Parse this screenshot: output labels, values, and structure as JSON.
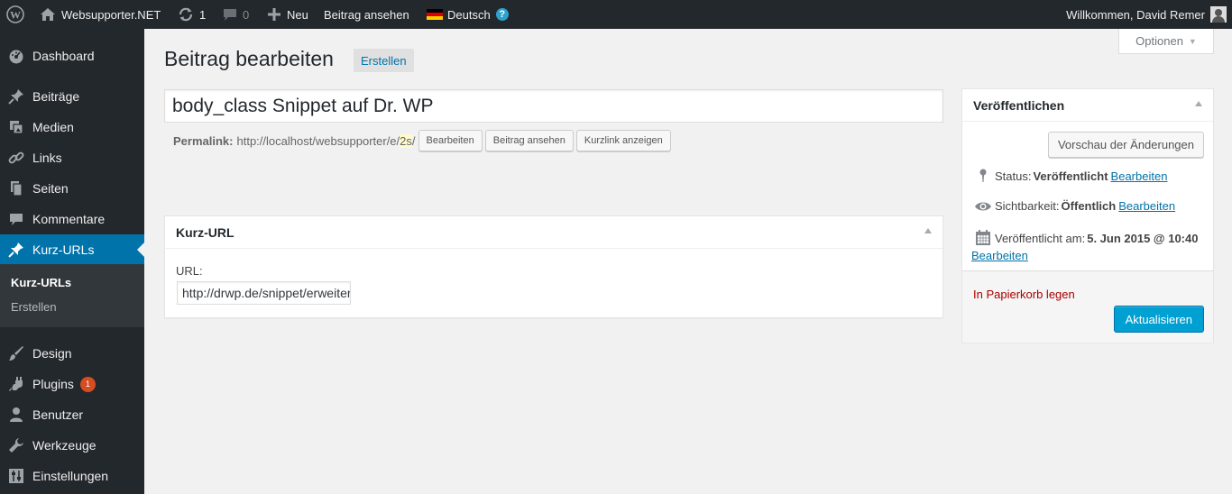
{
  "adminbar": {
    "site_name": "Websupporter.NET",
    "updates_count": "1",
    "comments_count": "0",
    "new_label": "Neu",
    "view_post_label": "Beitrag ansehen",
    "language_label": "Deutsch",
    "greeting": "Willkommen, David Remer"
  },
  "sidebar": {
    "items": {
      "dashboard": "Dashboard",
      "posts": "Beiträge",
      "media": "Medien",
      "links": "Links",
      "pages": "Seiten",
      "comments": "Kommentare",
      "shorturls": "Kurz-URLs",
      "design": "Design",
      "plugins": "Plugins",
      "users": "Benutzer",
      "tools": "Werkzeuge",
      "settings": "Einstellungen"
    },
    "submenu": {
      "current": "Kurz-URLs",
      "create": "Erstellen"
    },
    "plugins_badge": "1"
  },
  "screen_options": {
    "label": "Optionen"
  },
  "header": {
    "title": "Beitrag bearbeiten",
    "add_new": "Erstellen"
  },
  "post": {
    "title": "body_class Snippet auf Dr. WP",
    "permalink_label": "Permalink:",
    "permalink_base": "http://localhost/websupporter/e/",
    "permalink_slug": "2s",
    "permalink_trailing": "/",
    "edit_button": "Bearbeiten",
    "view_button": "Beitrag ansehen",
    "shortlink_button": "Kurzlink anzeigen"
  },
  "kurz_url_box": {
    "title": "Kurz-URL",
    "url_label": "URL:",
    "url_value": "http://drwp.de/snippet/erweitere-die-body_class"
  },
  "publish_box": {
    "title": "Veröffentlichen",
    "preview_button": "Vorschau der Änderungen",
    "status_label": "Status:",
    "status_value": "Veröffentlicht",
    "visibility_label": "Sichtbarkeit:",
    "visibility_value": "Öffentlich",
    "published_label": "Veröffentlicht am:",
    "published_value": "5. Jun 2015 @ 10:40",
    "edit_link": "Bearbeiten",
    "trash_link": "In Papierkorb legen",
    "update_button": "Aktualisieren"
  },
  "colors": {
    "adminbar_bg": "#23282d",
    "active_menu": "#0073aa",
    "primary_button": "#00a0d2",
    "trash": "#a00000",
    "badge": "#d54e21"
  }
}
